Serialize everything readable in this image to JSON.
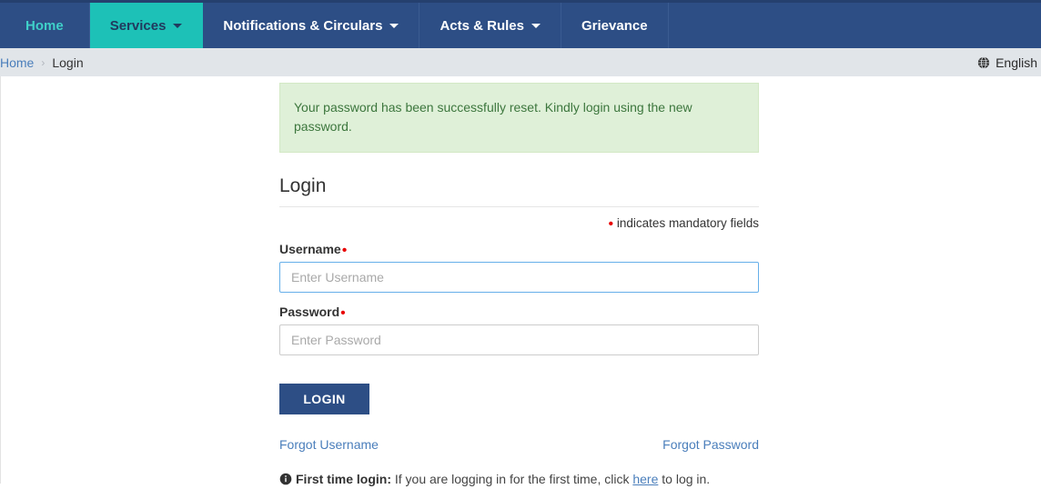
{
  "nav": {
    "items": [
      {
        "label": "Home",
        "has_caret": false,
        "active": false,
        "style": "home"
      },
      {
        "label": "Services",
        "has_caret": true,
        "active": true,
        "style": "normal"
      },
      {
        "label": "Notifications & Circulars",
        "has_caret": true,
        "active": false,
        "style": "normal"
      },
      {
        "label": "Acts & Rules",
        "has_caret": true,
        "active": false,
        "style": "normal"
      },
      {
        "label": "Grievance",
        "has_caret": false,
        "active": false,
        "style": "normal"
      }
    ],
    "active_bg": "#1dc1b7",
    "bar_bg": "#2d4e85"
  },
  "breadcrumb": {
    "home_label": "Home",
    "separator": "›",
    "current_label": "Login"
  },
  "language": {
    "icon": "globe-icon",
    "label": "English"
  },
  "alert": {
    "icon": "success-alert",
    "message": "Your password has been successfully reset. Kindly login using the new password.",
    "bg_color": "#dff0d8",
    "text_color": "#3c763d"
  },
  "form": {
    "heading": "Login",
    "mandatory_dot": "•",
    "mandatory_note": "indicates mandatory fields",
    "required_color": "#e80000",
    "username": {
      "label": "Username",
      "required_marker": "•",
      "placeholder": "Enter Username",
      "value": "",
      "focused": true
    },
    "password": {
      "label": "Password",
      "required_marker": "•",
      "placeholder": "Enter Password",
      "value": "",
      "focused": false
    },
    "submit_label": "LOGIN",
    "submit_color": "#2d4e85",
    "forgot_username_label": "Forgot Username",
    "forgot_password_label": "Forgot Password"
  },
  "first_time_note": {
    "icon": "info-circle-icon",
    "bold_prefix": "First time login:",
    "text_before_link": " If you are logging in for the first time, click ",
    "link_label": "here",
    "text_after_link": " to log in."
  }
}
